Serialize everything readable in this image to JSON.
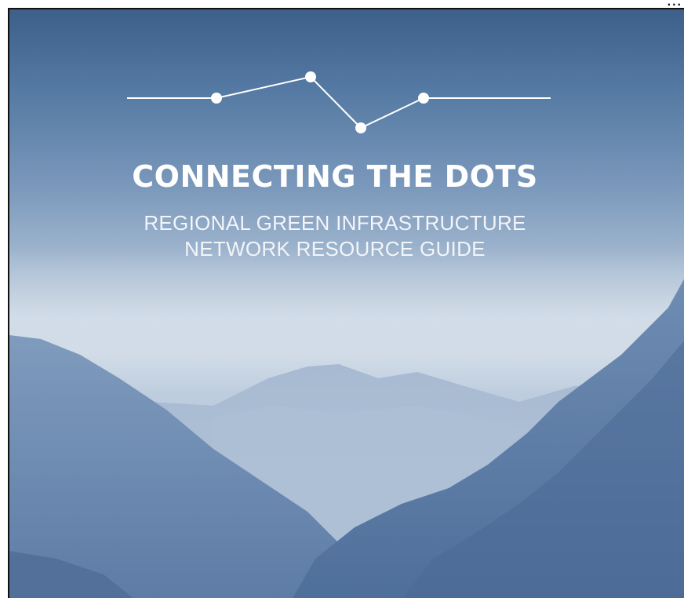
{
  "cover": {
    "title": "CONNECTING THE DOTS",
    "subtitle_line1": "REGIONAL GREEN INFRASTRUCTURE",
    "subtitle_line2": "NETWORK RESOURCE GUIDE",
    "corner_fragment": "...",
    "logo_icon": "connected-dots-line-icon",
    "background": "mountain-valley-photo",
    "colors": {
      "sky_top": "#3d5f8a",
      "haze": "#c7d4e2",
      "mountain_near": "#5f7ea6",
      "mountain_far": "#9fb3cc",
      "text": "#ffffff"
    }
  }
}
